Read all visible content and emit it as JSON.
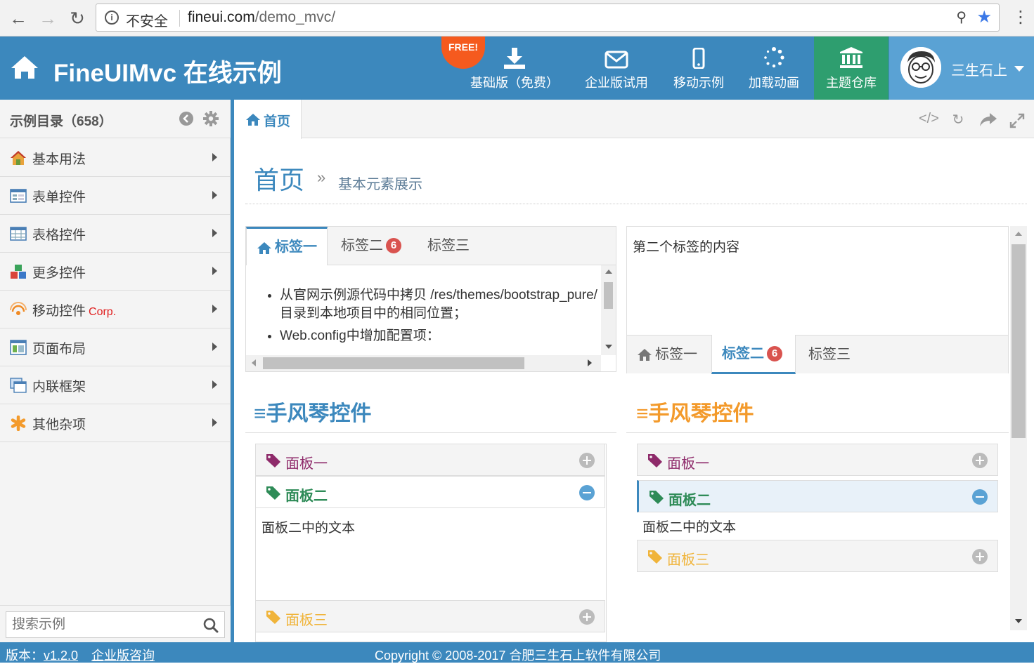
{
  "browser": {
    "insecure_label": "不安全",
    "url_host": "fineui.com",
    "url_path": "/demo_mvc/"
  },
  "header": {
    "title": "FineUIMvc 在线示例",
    "free_badge": "FREE!",
    "nav": [
      {
        "label": "基础版（免费）",
        "icon": "download-icon"
      },
      {
        "label": "企业版试用",
        "icon": "envelope-icon"
      },
      {
        "label": "移动示例",
        "icon": "mobile-icon"
      },
      {
        "label": "加载动画",
        "icon": "spinner-icon"
      },
      {
        "label": "主题仓库",
        "icon": "bank-icon"
      }
    ],
    "username": "三生石上"
  },
  "sidebar": {
    "title": "示例目录（658）",
    "items": [
      {
        "label": "基本用法",
        "icon": "home-icon"
      },
      {
        "label": "表单控件",
        "icon": "form-icon"
      },
      {
        "label": "表格控件",
        "icon": "table-icon"
      },
      {
        "label": "更多控件",
        "icon": "cubes-icon"
      },
      {
        "label": "移动控件",
        "extra": "Corp.",
        "icon": "rss-icon"
      },
      {
        "label": "页面布局",
        "icon": "layout-icon"
      },
      {
        "label": "内联框架",
        "icon": "iframe-icon"
      },
      {
        "label": "其他杂项",
        "icon": "asterisk-icon"
      }
    ],
    "search_placeholder": "搜索示例"
  },
  "main": {
    "home_tab": "首页",
    "breadcrumb_home": "首页",
    "breadcrumb_sep": "»",
    "breadcrumb_sub": "基本元素展示"
  },
  "tabpanel1": {
    "tabs": [
      "标签一",
      "标签二",
      "标签三"
    ],
    "badge": "6",
    "items": [
      "从官网示例源代码中拷贝 /res/themes/bootstrap_pure/ 目录到本地项目中的相同位置；",
      "Web.config中增加配置项："
    ]
  },
  "tabpanel2": {
    "content": "第二个标签的内容",
    "tabs": [
      "标签一",
      "标签二",
      "标签三"
    ],
    "badge": "6"
  },
  "accordion1": {
    "title": "≡手风琴控件",
    "color": "#3c88bd",
    "panels": [
      "面板一",
      "面板二",
      "面板三"
    ],
    "body": "面板二中的文本"
  },
  "accordion2": {
    "title": "≡手风琴控件",
    "color": "#f39a2b",
    "panels": [
      "面板一",
      "面板二",
      "面板三"
    ],
    "body": "面板二中的文本"
  },
  "colors": {
    "panel1": "#8e2a6a",
    "panel2": "#2e8b57",
    "panel3": "#f0b43a"
  },
  "footer": {
    "version_label": "版本：",
    "version": "v1.2.0",
    "consult": "企业版咨询",
    "copyright": "Copyright © 2008-2017 合肥三生石上软件有限公司"
  }
}
